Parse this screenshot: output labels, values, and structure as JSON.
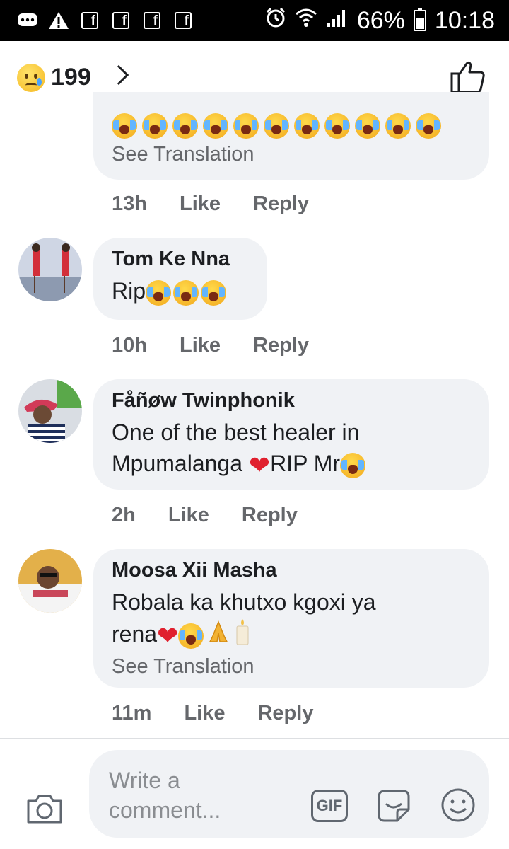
{
  "status_bar": {
    "battery": "66%",
    "time": "10:18",
    "battery_level": 0.66
  },
  "reactions": {
    "count": "199"
  },
  "comments": [
    {
      "partial": true,
      "emoji_count": 11,
      "see_translation": "See Translation",
      "time": "13h",
      "like": "Like",
      "reply": "Reply"
    },
    {
      "name": "Tom Ke Nna",
      "text": "Rip",
      "time": "10h",
      "like": "Like",
      "reply": "Reply"
    },
    {
      "name": "Fåñøw Twinphonik",
      "text_line1": "One of the best healer in",
      "text_line2a": "Mpumalanga",
      "text_line2b": "RIP Mr",
      "time": "2h",
      "like": "Like",
      "reply": "Reply"
    },
    {
      "name": "Moosa Xii Masha",
      "text_line1": "Robala ka khutxo kgoxi ya",
      "text_line2": "rena",
      "see_translation": "See Translation",
      "time": "11m",
      "like": "Like",
      "reply": "Reply"
    }
  ],
  "composer": {
    "placeholder_line1": "Write a",
    "placeholder_line2": "comment...",
    "gif_label": "GIF"
  }
}
